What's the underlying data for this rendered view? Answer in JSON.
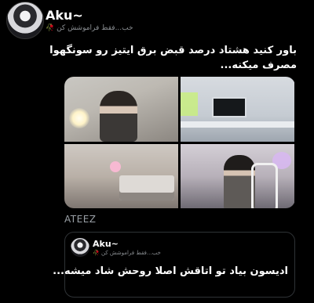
{
  "author": {
    "name": "Aku~",
    "handle": "خب...فقط فراموشش کن 🥀"
  },
  "tweet": {
    "lines": [
      "باور کنید هشتاد درصد قبض برق ایتیز رو سونگهوا",
      "مصرف میکنه..."
    ]
  },
  "media": {
    "photos": [
      "photo-1",
      "photo-2",
      "photo-3",
      "photo-4"
    ]
  },
  "caption": "ATEEZ",
  "quote": {
    "name": "Aku~",
    "handle": "خب...فقط فراموشش کن 🥀",
    "text": "ادیسون بیاد تو اتاقش اصلا روحش شاد میشه..."
  }
}
